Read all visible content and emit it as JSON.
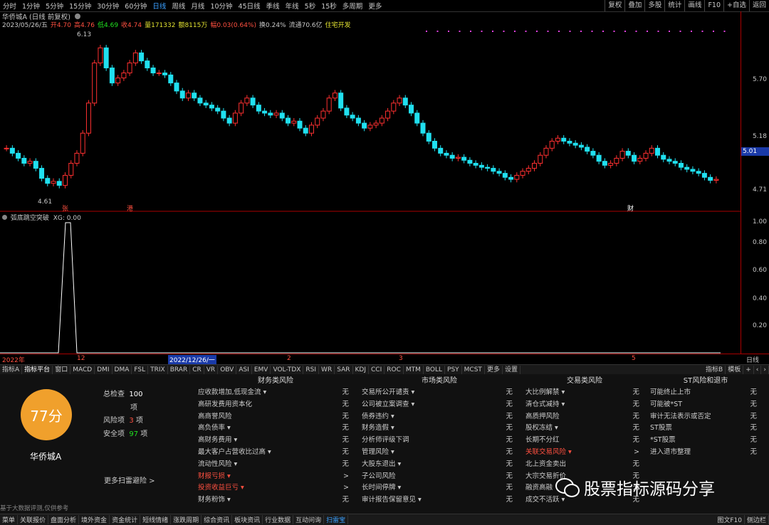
{
  "toolbar": {
    "timeframes": [
      "分时",
      "1分钟",
      "5分钟",
      "15分钟",
      "30分钟",
      "60分钟",
      "日线",
      "周线",
      "月线",
      "10分钟",
      "45日线",
      "季线",
      "年线",
      "5秒",
      "15秒",
      "多周期",
      "更多"
    ],
    "active_index": 6,
    "right_buttons": [
      "复权",
      "叠加",
      "多股",
      "统计",
      "画线",
      "F10",
      "+自选",
      "返回"
    ]
  },
  "header": {
    "stock_title": "华侨城A (日线 前复权)",
    "date": "2023/05/26/五",
    "open": "开4.70",
    "high": "高4.76",
    "low": "低4.69",
    "close": "收4.74",
    "volume": "量171332",
    "amount": "额8115万",
    "change": "幅0.03(0.64%)",
    "turnover": "换0.24%",
    "float_cap": "流通70.6亿",
    "sector": "住宅开发"
  },
  "price_axis": {
    "ticks": [
      "5.70",
      "5.18",
      "4.71"
    ],
    "current_price": "5.01"
  },
  "chart_annotations": {
    "high_label": "6.13",
    "low_label": "4.61",
    "markers": [
      "张",
      "港",
      "财"
    ]
  },
  "indicator": {
    "name": "弧底跳空突破",
    "value_label": "XG: 0.00",
    "ticks": [
      "1.00",
      "0.80",
      "0.60",
      "0.40",
      "0.20"
    ]
  },
  "date_axis": {
    "labels": [
      "2022年",
      "12",
      "2022/12/26/一",
      "2",
      "3",
      "5"
    ],
    "period": "日线"
  },
  "indicator_tabs": {
    "items": [
      "指标A",
      "指标平台",
      "窗口",
      "MACD",
      "DMI",
      "DMA",
      "FSL",
      "TRIX",
      "BRAR",
      "CR",
      "VR",
      "OBV",
      "ASI",
      "EMV",
      "VOL-TDX",
      "RSI",
      "WR",
      "SAR",
      "KDJ",
      "CCI",
      "ROC",
      "MTM",
      "BOLL",
      "PSY",
      "MCST",
      "更多",
      "设置"
    ],
    "right": [
      "指标B",
      "模板",
      "+",
      "‹",
      "›"
    ]
  },
  "risk_panel": {
    "score": "77分",
    "summary": {
      "check_label": "总检查",
      "check_value": "100",
      "check_unit": "项",
      "risk_label": "风险项",
      "risk_value": "3",
      "risk_unit": "项",
      "safe_label": "安全项",
      "safe_value": "97",
      "safe_unit": "项"
    },
    "stock_name": "华侨城A",
    "more_link": "更多扫雷避险 >",
    "disclaimer": "基于大数据评测,仅供参考",
    "columns": [
      {
        "title": "财务类风险",
        "items": [
          {
            "label": "应收款增加,低现金流 ▾",
            "status": "无",
            "risk": false
          },
          {
            "label": "高研发费用资本化",
            "status": "无",
            "risk": false
          },
          {
            "label": "高商誉风险",
            "status": "无",
            "risk": false
          },
          {
            "label": "高负债率 ▾",
            "status": "无",
            "risk": false
          },
          {
            "label": "高财务费用 ▾",
            "status": "无",
            "risk": false
          },
          {
            "label": "最大客户占营收比过高 ▾",
            "status": "无",
            "risk": false
          },
          {
            "label": "流动性风险 ▾",
            "status": "无",
            "risk": false
          },
          {
            "label": "财报亏损 ▾",
            "status": ">",
            "risk": true
          },
          {
            "label": "投资收益巨亏 ▾",
            "status": ">",
            "risk": true
          },
          {
            "label": "财务粉饰 ▾",
            "status": "无",
            "risk": false
          }
        ]
      },
      {
        "title": "市场类风险",
        "items": [
          {
            "label": "交易所公开谴责 ▾",
            "status": "无",
            "risk": false
          },
          {
            "label": "公司被立案调查 ▾",
            "status": "无",
            "risk": false
          },
          {
            "label": "债券违约 ▾",
            "status": "无",
            "risk": false
          },
          {
            "label": "财务造假 ▾",
            "status": "无",
            "risk": false
          },
          {
            "label": "分析师评级下调",
            "status": "无",
            "risk": false
          },
          {
            "label": "管理风险 ▾",
            "status": "无",
            "risk": false
          },
          {
            "label": "大股东退出 ▾",
            "status": "无",
            "risk": false
          },
          {
            "label": "子公司风险",
            "status": "无",
            "risk": false
          },
          {
            "label": "长时间停牌 ▾",
            "status": "无",
            "risk": false
          },
          {
            "label": "审计报告保留意见 ▾",
            "status": "无",
            "risk": false
          }
        ]
      },
      {
        "title": "交易类风险",
        "items": [
          {
            "label": "大比例解禁 ▾",
            "status": "无",
            "risk": false
          },
          {
            "label": "清仓式减持 ▾",
            "status": "无",
            "risk": false
          },
          {
            "label": "高质押风险",
            "status": "无",
            "risk": false
          },
          {
            "label": "股权冻结 ▾",
            "status": "无",
            "risk": false
          },
          {
            "label": "长期不分红",
            "status": "无",
            "risk": false
          },
          {
            "label": "关联交易风险 ▾",
            "status": ">",
            "risk": true
          },
          {
            "label": "北上资金卖出",
            "status": "无",
            "risk": false
          },
          {
            "label": "大宗交易折价",
            "status": "无",
            "risk": false
          },
          {
            "label": "融资高融",
            "status": "无",
            "risk": false
          },
          {
            "label": "成交不活跃 ▾",
            "status": "无",
            "risk": false
          }
        ]
      },
      {
        "title": "ST风险和退市",
        "items": [
          {
            "label": "可能终止上市",
            "status": "无",
            "risk": false
          },
          {
            "label": "可能被*ST",
            "status": "无",
            "risk": false
          },
          {
            "label": "审计无法表示或否定",
            "status": "无",
            "risk": false
          },
          {
            "label": "ST股票",
            "status": "无",
            "risk": false
          },
          {
            "label": "*ST股票",
            "status": "无",
            "risk": false
          },
          {
            "label": "进入退市整理",
            "status": "无",
            "risk": false
          }
        ]
      }
    ]
  },
  "watermark": "股票指标源码分享",
  "statusbar": {
    "items": [
      "菜单",
      "关联报价",
      "盘面分析",
      "境外资金",
      "资金统计",
      "短线情绪",
      "涨跌周期",
      "综合资讯",
      "板块资讯",
      "行业数据",
      "互动问询",
      "扫雷宝"
    ],
    "active_index": 11,
    "right": [
      "图文F10",
      "侧边栏"
    ]
  },
  "colors": {
    "up": "#ff3030",
    "down": "#20e0f0",
    "accent": "#3aa0ff",
    "score": "#f0a02c"
  }
}
